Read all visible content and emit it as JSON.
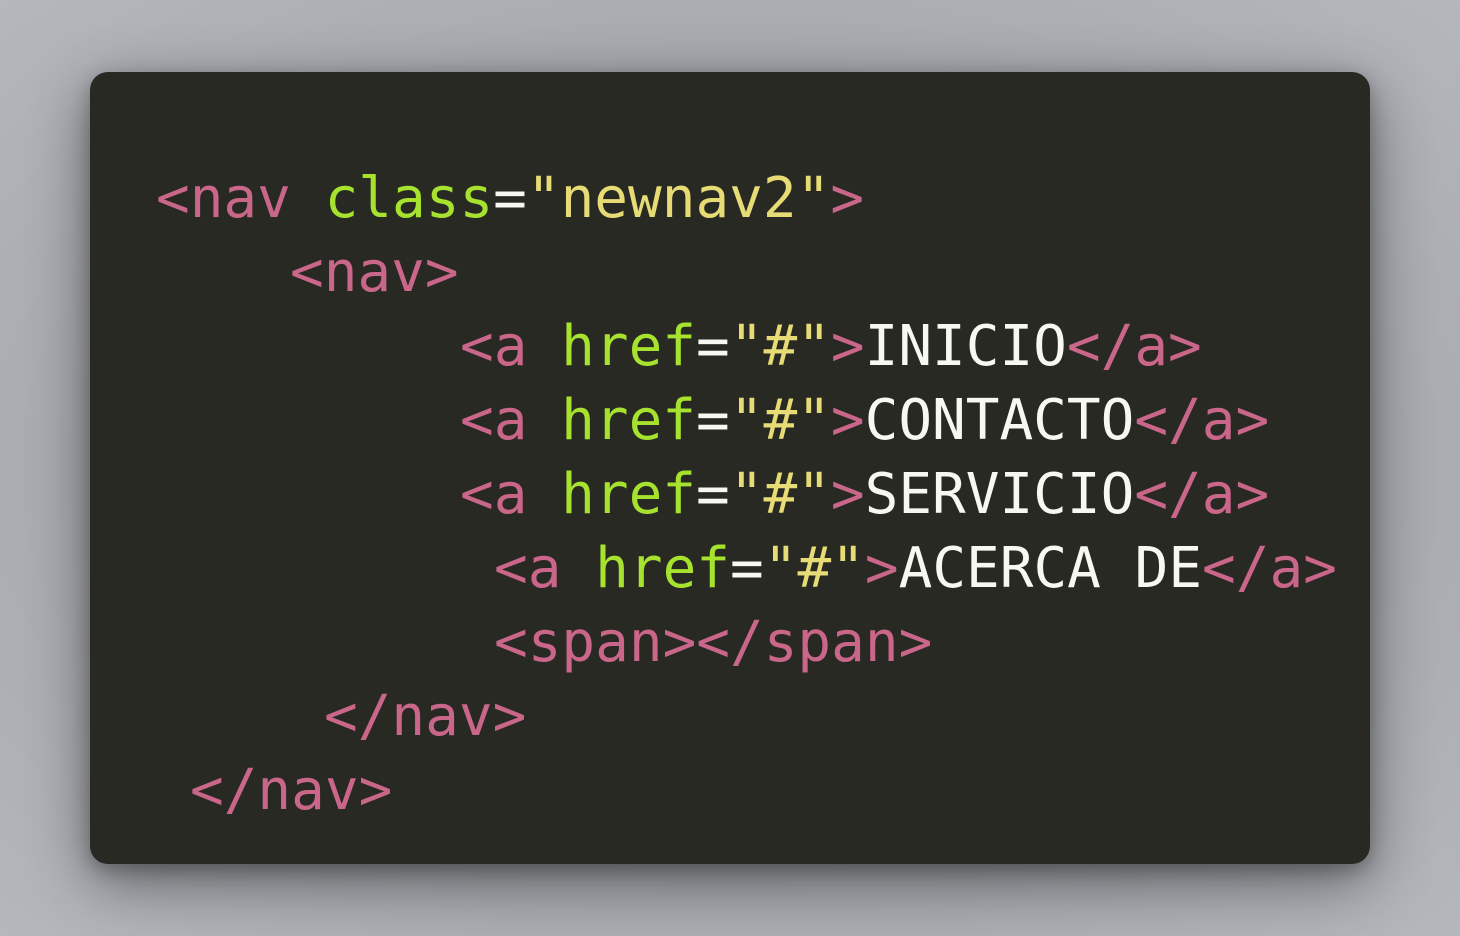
{
  "code": {
    "lines": [
      {
        "indent": 0,
        "tokens": [
          {
            "type": "tag",
            "text": "<nav"
          },
          {
            "type": "space",
            "text": " "
          },
          {
            "type": "attr",
            "text": "class"
          },
          {
            "type": "punct",
            "text": "="
          },
          {
            "type": "str",
            "text": "\"newnav2\""
          },
          {
            "type": "tag",
            "text": ">"
          }
        ]
      },
      {
        "indent": 1,
        "tokens": [
          {
            "type": "tag",
            "text": "<nav>"
          }
        ]
      },
      {
        "indent": 2,
        "tokens": [
          {
            "type": "tag",
            "text": "<a"
          },
          {
            "type": "space",
            "text": " "
          },
          {
            "type": "attr",
            "text": "href"
          },
          {
            "type": "punct",
            "text": "="
          },
          {
            "type": "str",
            "text": "\"#\""
          },
          {
            "type": "tag",
            "text": ">"
          },
          {
            "type": "text",
            "text": "INICIO"
          },
          {
            "type": "tag",
            "text": "</a>"
          }
        ]
      },
      {
        "indent": 2,
        "tokens": [
          {
            "type": "tag",
            "text": "<a"
          },
          {
            "type": "space",
            "text": " "
          },
          {
            "type": "attr",
            "text": "href"
          },
          {
            "type": "punct",
            "text": "="
          },
          {
            "type": "str",
            "text": "\"#\""
          },
          {
            "type": "tag",
            "text": ">"
          },
          {
            "type": "text",
            "text": "CONTACTO"
          },
          {
            "type": "tag",
            "text": "</a>"
          }
        ]
      },
      {
        "indent": 2,
        "tokens": [
          {
            "type": "tag",
            "text": "<a"
          },
          {
            "type": "space",
            "text": " "
          },
          {
            "type": "attr",
            "text": "href"
          },
          {
            "type": "punct",
            "text": "="
          },
          {
            "type": "str",
            "text": "\"#\""
          },
          {
            "type": "tag",
            "text": ">"
          },
          {
            "type": "text",
            "text": "SERVICIO"
          },
          {
            "type": "tag",
            "text": "</a>"
          }
        ]
      },
      {
        "indent": 3,
        "tokens": [
          {
            "type": "tag",
            "text": "<a"
          },
          {
            "type": "space",
            "text": " "
          },
          {
            "type": "attr",
            "text": "href"
          },
          {
            "type": "punct",
            "text": "="
          },
          {
            "type": "str",
            "text": "\"#\""
          },
          {
            "type": "tag",
            "text": ">"
          },
          {
            "type": "text",
            "text": "ACERCA DE"
          },
          {
            "type": "tag",
            "text": "</a>"
          }
        ]
      },
      {
        "indent": 3,
        "tokens": [
          {
            "type": "tag",
            "text": "<span></span>"
          }
        ]
      },
      {
        "indent": 4,
        "tokens": [
          {
            "type": "tag",
            "text": "</nav>"
          }
        ]
      },
      {
        "indent": 5,
        "tokens": [
          {
            "type": "tag",
            "text": "</nav>"
          }
        ]
      }
    ]
  },
  "colors": {
    "background": "#282923",
    "tag": "#c9668a",
    "attribute": "#a6e22e",
    "string": "#e6db74",
    "text": "#f8f8f2"
  }
}
